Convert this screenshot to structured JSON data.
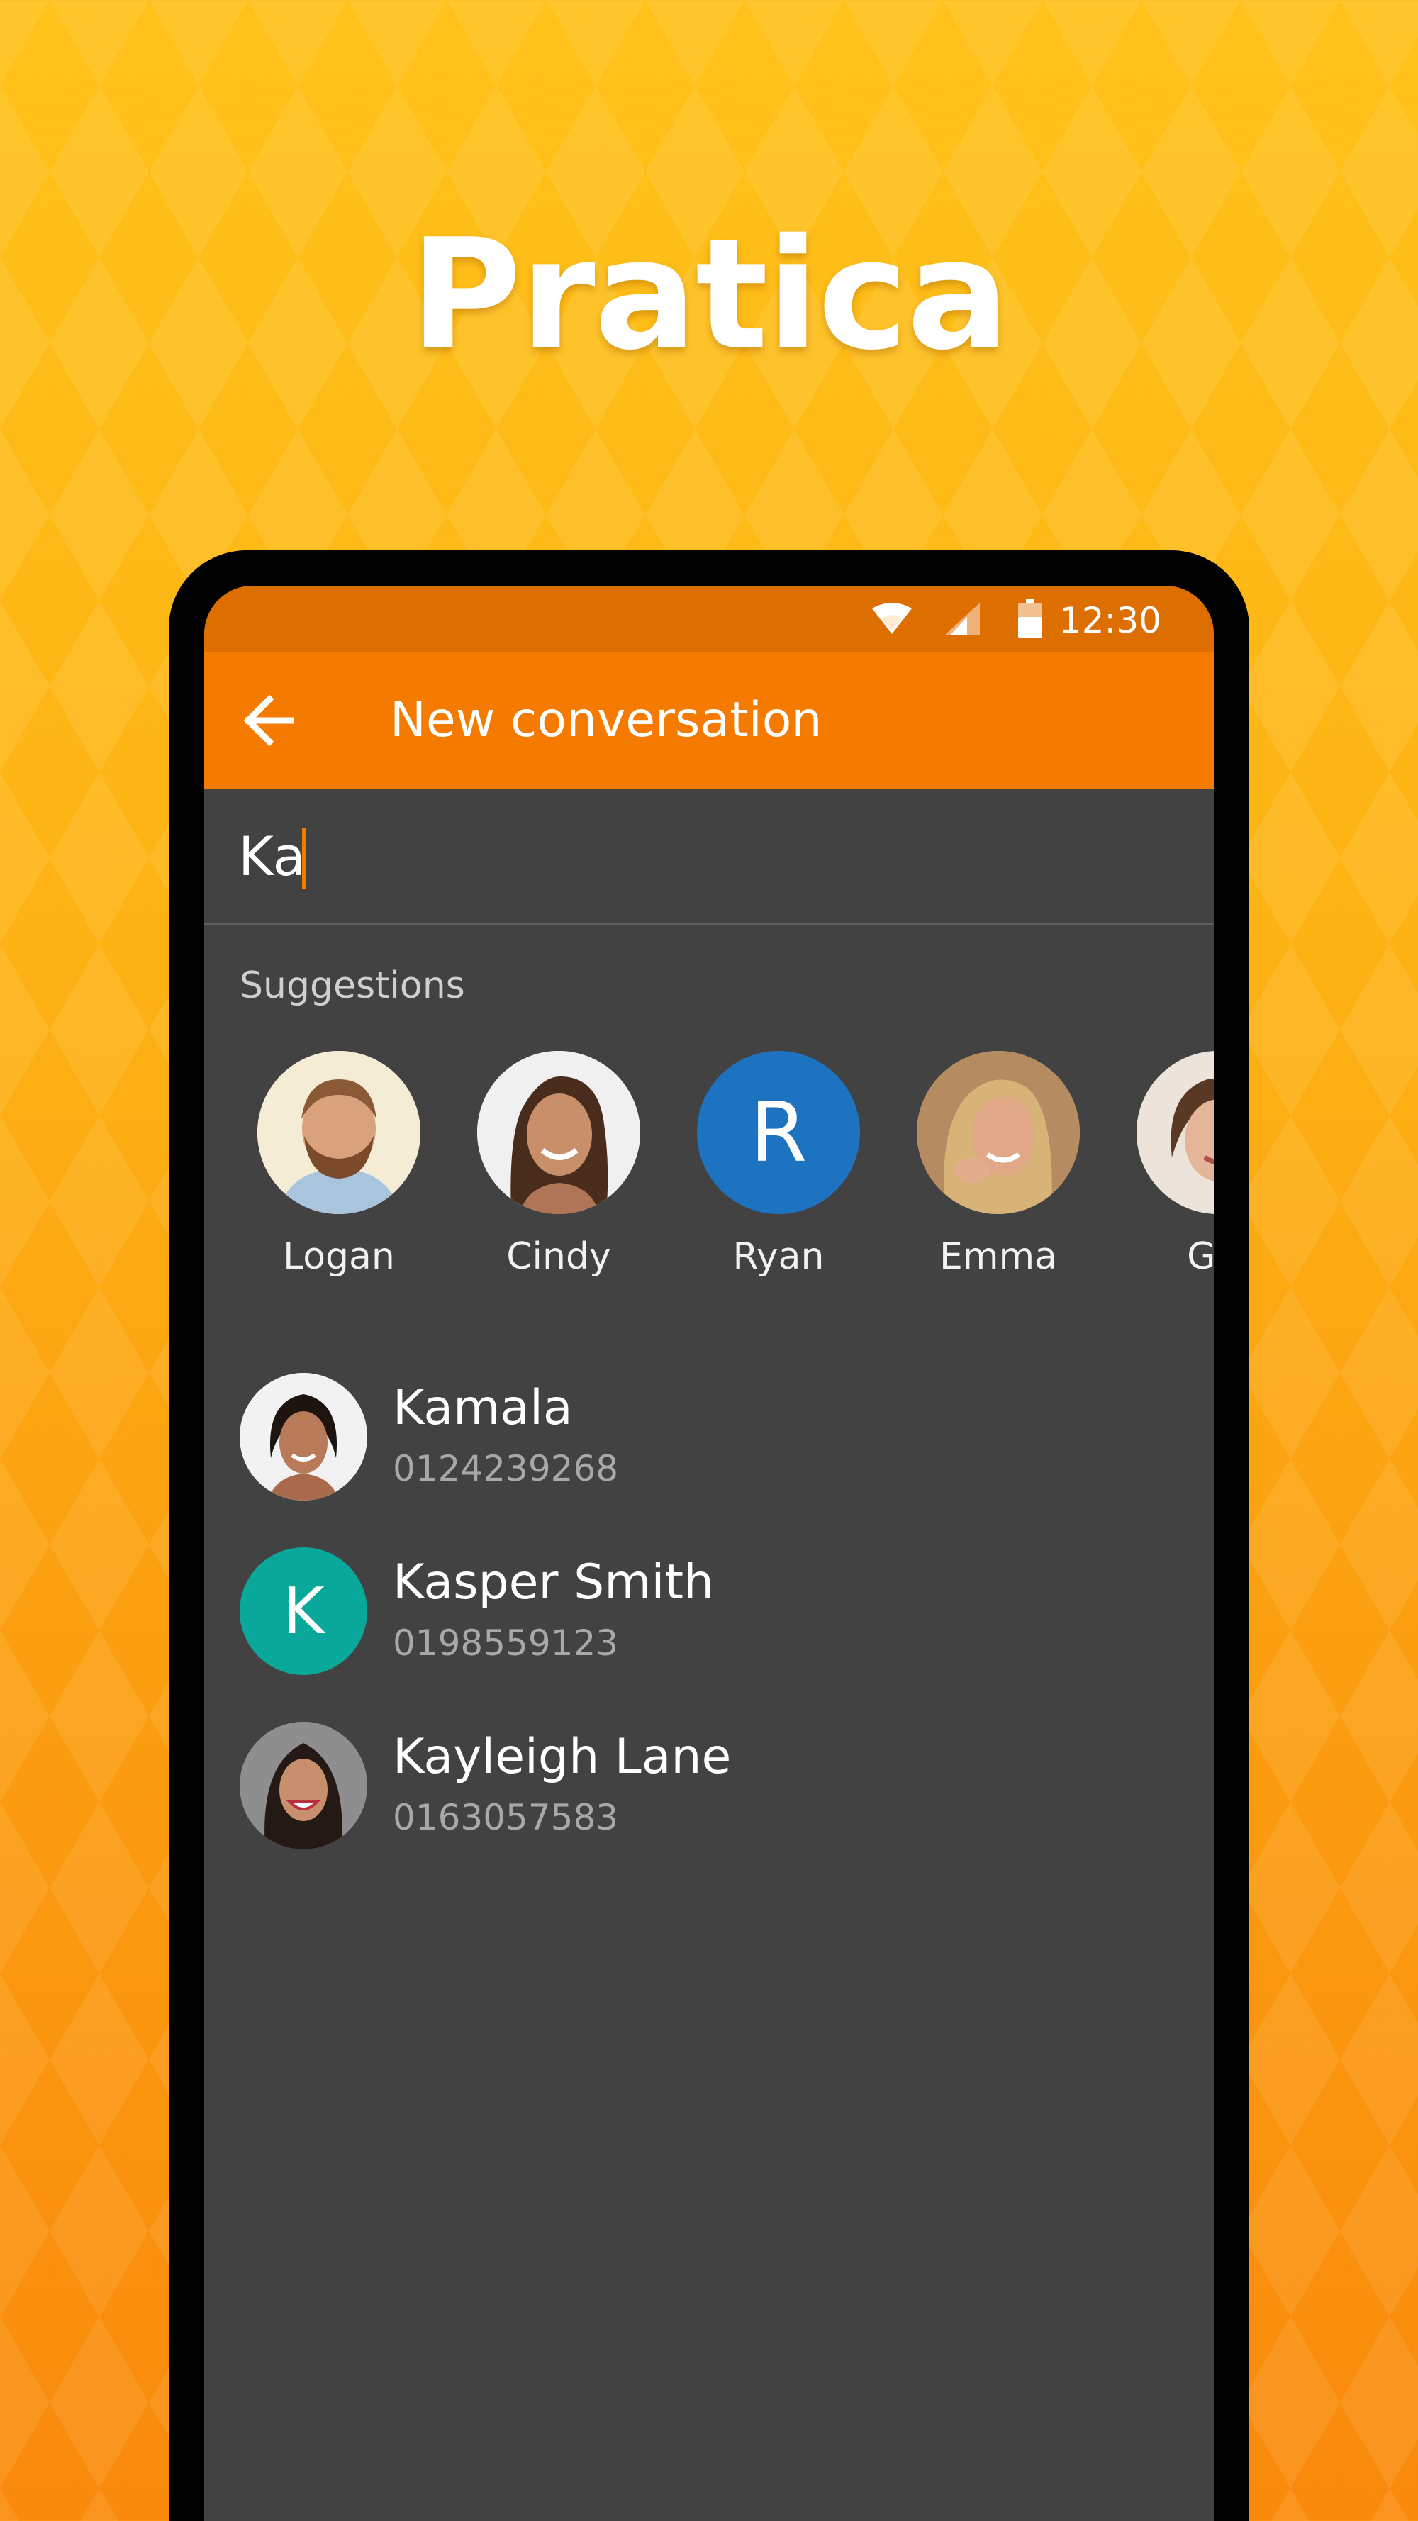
{
  "headline": "Pratica",
  "status": {
    "time": "12:30",
    "icons": [
      "wifi-icon",
      "signal-icon",
      "battery-icon"
    ]
  },
  "appbar": {
    "title": "New conversation",
    "back_icon": "arrow-left-icon"
  },
  "search": {
    "value": "Ka"
  },
  "suggestions": {
    "label": "Suggestions",
    "items": [
      {
        "name": "Logan"
      },
      {
        "name": "Cindy"
      },
      {
        "name": "Ryan",
        "initial": "R"
      },
      {
        "name": "Emma"
      },
      {
        "name": "Gin"
      }
    ]
  },
  "contacts": [
    {
      "name": "Kamala",
      "phone": "0124239268"
    },
    {
      "name": "Kasper Smith",
      "phone": "0198559123",
      "initial": "K"
    },
    {
      "name": "Kayleigh Lane",
      "phone": "0163057583"
    }
  ],
  "colors": {
    "appbar": "#f47b00",
    "statusbar": "#dd6e00",
    "screen_bg": "#424242",
    "ryan_avatar": "#1e73c0",
    "kasper_avatar": "#0aa79b",
    "caret": "#f47b00"
  }
}
